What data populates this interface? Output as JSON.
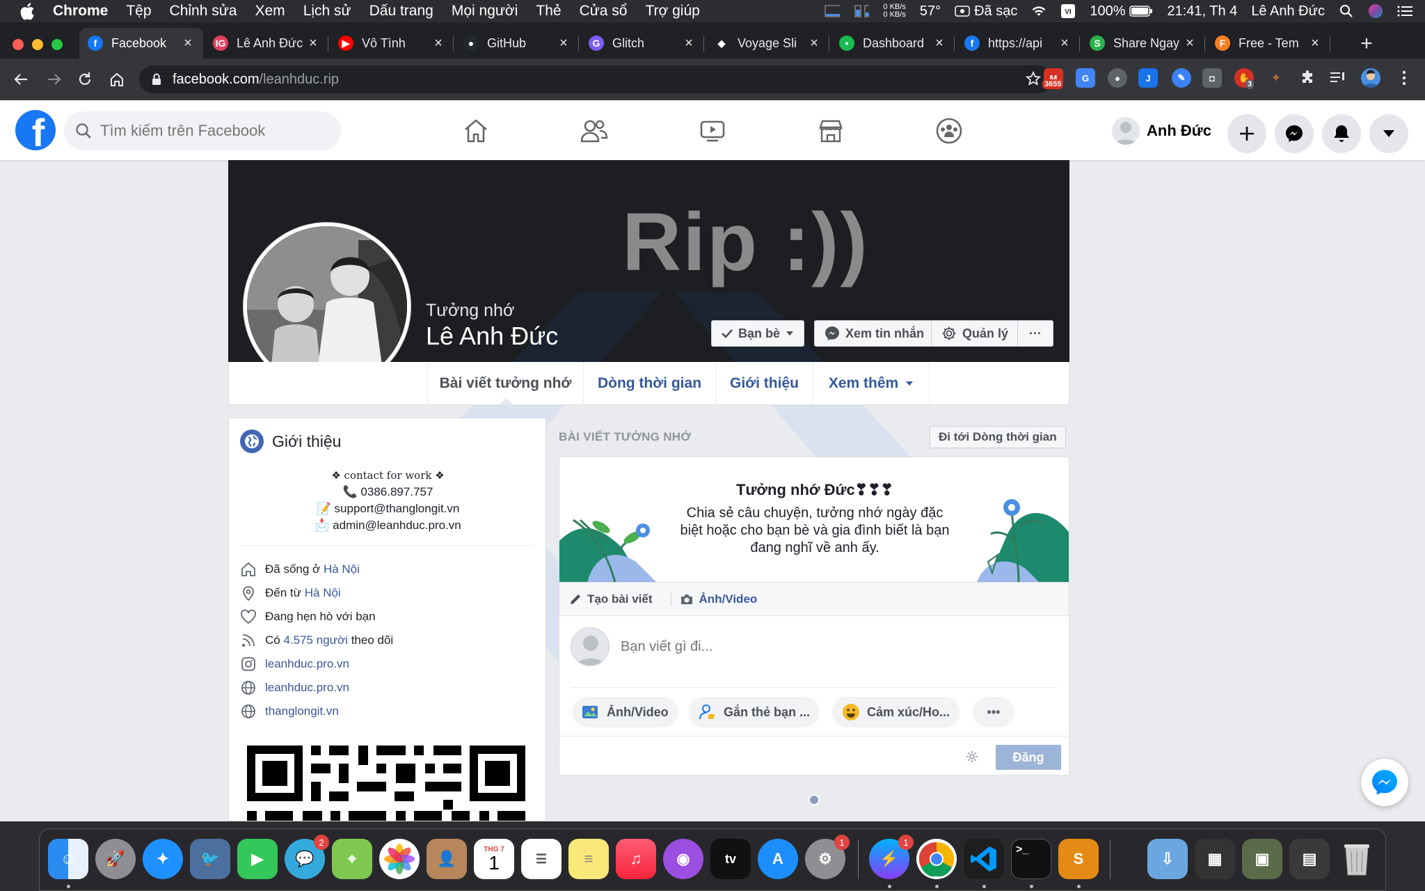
{
  "menubar": {
    "app": "Chrome",
    "items": [
      "Tệp",
      "Chỉnh sửa",
      "Xem",
      "Lịch sử",
      "Dấu trang",
      "Mọi người",
      "Thẻ",
      "Cửa sổ",
      "Trợ giúp"
    ],
    "net_up": "0 KB/s",
    "net_down": "0 KB/s",
    "temp": "57°",
    "charging": "Đã sạc",
    "battery": "100%",
    "clock": "21:41, Th 4",
    "user": "Lê Anh Đức"
  },
  "tabs": [
    {
      "title": "Facebook",
      "active": true,
      "color": "#1877f2",
      "glyph": "f"
    },
    {
      "title": "Lê Anh Đức",
      "color": "#e4405f",
      "glyph": "IG"
    },
    {
      "title": "Vô Tình",
      "color": "#ff0000",
      "glyph": "▶"
    },
    {
      "title": "GitHub",
      "color": "#24292e",
      "glyph": "●"
    },
    {
      "title": "Glitch",
      "color": "#7b5cf5",
      "glyph": "G"
    },
    {
      "title": "Voyage Sli",
      "color": "#202124",
      "glyph": "◆"
    },
    {
      "title": "Dashboard",
      "color": "#1db954",
      "glyph": "•"
    },
    {
      "title": "https://api",
      "color": "#1877f2",
      "glyph": "f"
    },
    {
      "title": "Share Ngay",
      "color": "#2bb24c",
      "glyph": "S"
    },
    {
      "title": "Free - Tem",
      "color": "#f48024",
      "glyph": "F"
    }
  ],
  "omnibox": {
    "host": "facebook.com",
    "path": "/leanhduc.rip"
  },
  "ext_badges": {
    "gmail": "3655",
    "other": "3"
  },
  "fb": {
    "search_placeholder": "Tìm kiếm trên Facebook",
    "user_name": "Anh Đức"
  },
  "profile": {
    "cover_text": "Rip :))",
    "memorial_label": "Tưởng nhớ",
    "name": "Lê Anh Đức",
    "friends_btn": "Bạn bè",
    "messages_btn": "Xem tin nhắn",
    "manage_btn": "Quản lý",
    "more_btn": "···",
    "tabs": [
      "Bài viết tưởng nhớ",
      "Dòng thời gian",
      "Giới thiệu",
      "Xem thêm"
    ]
  },
  "intro": {
    "title": "Giới thiệu",
    "bio_line1": "❖ contact for work ❖",
    "bio_line2": "📞 0386.897.757",
    "bio_line3": "📝 support@thanglongit.vn",
    "bio_line4": "📩 admin@leanhduc.pro.vn",
    "lived_prefix": "Đã sống ở",
    "lived_place": "Hà Nội",
    "from_prefix": "Đến từ",
    "from_place": "Hà Nội",
    "relationship": "Đang hẹn hò với bạn",
    "followers_prefix": "Có",
    "followers_link": "4.575 người",
    "followers_suffix": "theo dõi",
    "instagram": "leanhduc.pro.vn",
    "website1": "leanhduc.pro.vn",
    "website2": "thanglongit.vn"
  },
  "memorial": {
    "section_label": "BÀI VIẾT TƯỞNG NHỚ",
    "goto_timeline": "Đi tới Dòng thời gian",
    "tribute_title": "Tưởng nhớ Đức❣❣❣",
    "tribute_desc": "Chia sẻ câu chuyện, tưởng nhớ ngày đặc biệt hoặc cho bạn bè và gia đình biết là bạn đang nghĩ về anh ấy.",
    "create_post": "Tạo bài viết",
    "photo_video_tab": "Ảnh/Video",
    "composer_placeholder": "Bạn viết gì đi...",
    "pill_photo": "Ảnh/Video",
    "pill_tag": "Gắn thẻ bạn ...",
    "pill_feeling": "Cảm xúc/Ho...",
    "pill_more": "•••",
    "post_btn": "Đăng"
  },
  "dock": {
    "badges": {
      "messages": "2",
      "settings": "1",
      "messenger": "1"
    },
    "calendar_month": "THG 7",
    "calendar_day": "1",
    "tv_label": "tv"
  }
}
